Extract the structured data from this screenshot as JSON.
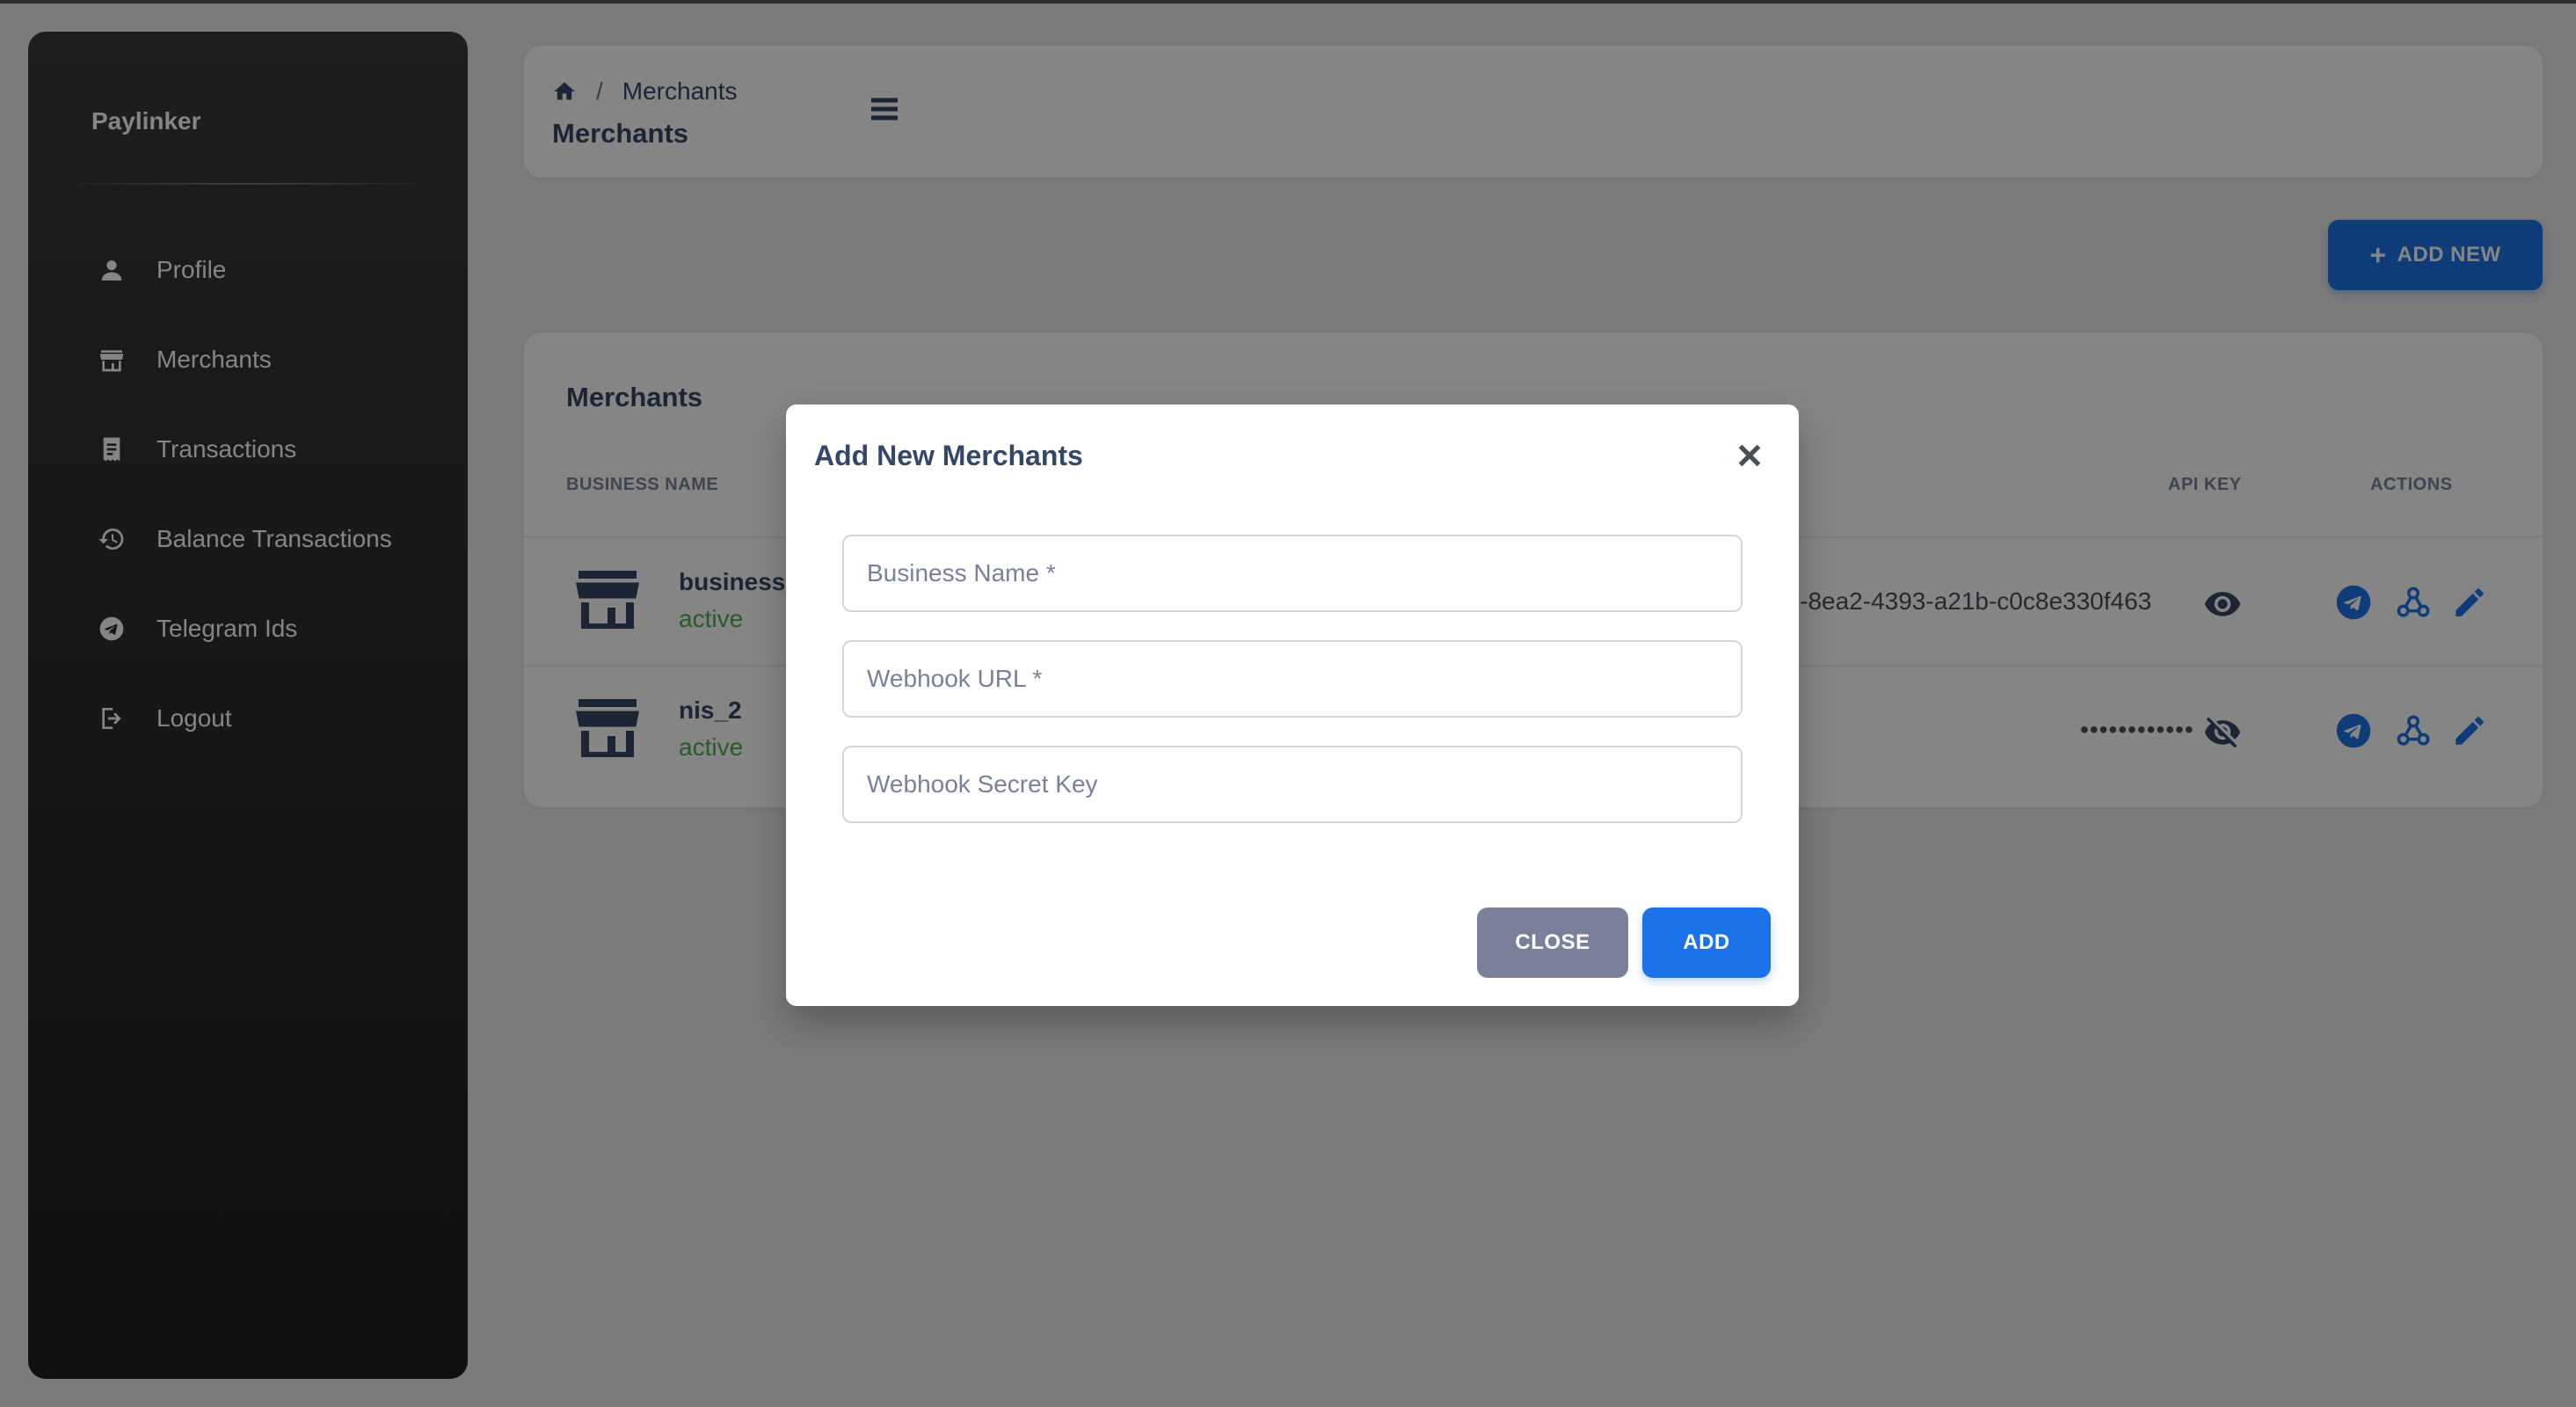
{
  "sidebar": {
    "brand": "Paylinker",
    "items": [
      {
        "label": "Profile",
        "icon": "person-icon"
      },
      {
        "label": "Merchants",
        "icon": "store-icon"
      },
      {
        "label": "Transactions",
        "icon": "receipt-icon"
      },
      {
        "label": "Balance Transactions",
        "icon": "history-icon"
      },
      {
        "label": "Telegram Ids",
        "icon": "telegram-icon"
      },
      {
        "label": "Logout",
        "icon": "logout-icon"
      }
    ]
  },
  "header": {
    "breadcrumb_current": "Merchants",
    "breadcrumb_sep": "/",
    "title": "Merchants"
  },
  "add_new_label": "ADD NEW",
  "merchants": {
    "title": "Merchants",
    "columns": {
      "business_name": "BUSINESS NAME",
      "api_key": "API KEY",
      "actions": "ACTIONS"
    },
    "rows": [
      {
        "name": "business_",
        "status": "active",
        "api_key": "de-8ea2-4393-a21b-c0c8e330f463",
        "key_visible": true
      },
      {
        "name": "nis_2",
        "status": "active",
        "api_key": "••••••••••••",
        "key_visible": false
      }
    ]
  },
  "modal": {
    "title": "Add New Merchants",
    "fields": {
      "business_name": "Business Name *",
      "webhook_url": "Webhook URL *",
      "webhook_secret": "Webhook Secret Key"
    },
    "close_label": "CLOSE",
    "add_label": "ADD"
  },
  "colors": {
    "primary": "#1a73e8",
    "secondary": "#7b809a",
    "success": "#4caf50",
    "text": "#344767"
  }
}
